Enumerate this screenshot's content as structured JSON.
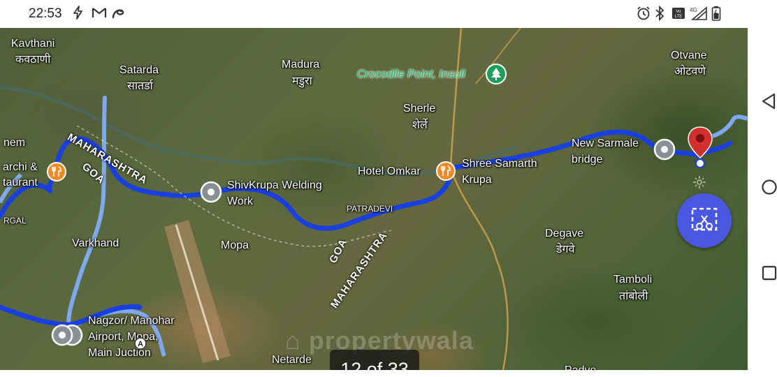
{
  "status_bar": {
    "time": "22:53",
    "left_icons": [
      "power-icon",
      "gmail-icon",
      "swirl-icon"
    ],
    "right_icons": [
      "alarm-icon",
      "bluetooth-icon",
      "volte-icon",
      "signal-4g-icon",
      "battery-icon"
    ],
    "network_label": "4G"
  },
  "map": {
    "places": {
      "kavthani": "Kavthani",
      "kavthani_local": "कवठाणी",
      "satarda": "Satarda",
      "satarda_local": "सातर्डा",
      "madura": "Madura",
      "madura_local": "मडुरा",
      "crocodile_point": "Crocodile Point, Insuli",
      "otvane": "Otvane",
      "otvane_local": "ओटवणे",
      "sherle": "Sherle",
      "sherle_local": "शेर्ले",
      "nem": "nem",
      "archi": "archi &",
      "taurant": "taurant",
      "rgal": "RGAL",
      "hotel_omkar": "Hotel Omkar",
      "shree_samarth": "Shree Samarth",
      "krupa": "Krupa",
      "new_sarmale": "New Sarmale",
      "bridge": "bridge",
      "shivkrupa": "ShivKrupa Welding",
      "work": "Work",
      "patradevi": "PATRADEVI",
      "varkhand": "Varkhand",
      "mopa": "Mopa",
      "degave": "Degave",
      "degave_local": "डेगवे",
      "tamboli": "Tamboli",
      "tamboli_local": "तांबोली",
      "nagzor1": "Nagzor/ Manohar",
      "nagzor2": "Airport, Mopa,",
      "nagzor3": "Main Juction",
      "netarde": "Netarde",
      "padve": "Padve"
    },
    "states": {
      "maharashtra_top": "MAHARASHTRA",
      "goa_top": "GOA",
      "goa_mid": "GOA",
      "maharashtra_mid": "MAHARASHTRA"
    },
    "watermark": "propertywala",
    "image_counter": "12 of 33",
    "colors": {
      "route": "#1a3fe0",
      "route_alt": "#7fa8f0",
      "pin_red": "#d32f2f",
      "fab": "#4a57e0",
      "poi_orange": "#f08a24",
      "poi_green": "#1fb86a"
    }
  },
  "nav_bar": {
    "buttons": [
      "back-icon",
      "home-icon",
      "recents-icon"
    ]
  }
}
